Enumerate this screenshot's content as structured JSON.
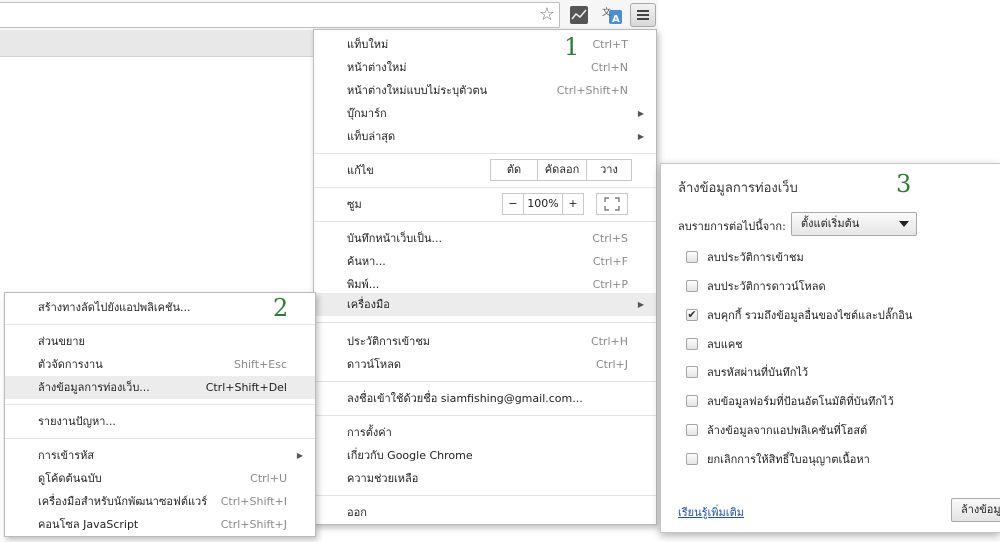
{
  "annotations": {
    "n1": "1",
    "n2": "2",
    "n3": "3"
  },
  "main_menu": {
    "new_tab": {
      "label": "แท็บใหม่",
      "shortcut": "Ctrl+T"
    },
    "new_window": {
      "label": "หน้าต่างใหม่",
      "shortcut": "Ctrl+N"
    },
    "new_incognito": {
      "label": "หน้าต่างใหม่แบบไม่ระบุตัวตน",
      "shortcut": "Ctrl+Shift+N"
    },
    "bookmarks": {
      "label": "บุ๊กมาร์ก"
    },
    "recent_tabs": {
      "label": "แท็บล่าสุด"
    },
    "edit": {
      "label": "แก้ไข",
      "cut": "ตัด",
      "copy": "คัดลอก",
      "paste": "วาง"
    },
    "zoom": {
      "label": "ซูม",
      "minus": "−",
      "value": "100%",
      "plus": "+"
    },
    "save_page": {
      "label": "บันทึกหน้าเว็บเป็น...",
      "shortcut": "Ctrl+S"
    },
    "find": {
      "label": "ค้นหา...",
      "shortcut": "Ctrl+F"
    },
    "print": {
      "label": "พิมพ์...",
      "shortcut": "Ctrl+P"
    },
    "tools": {
      "label": "เครื่องมือ"
    },
    "history": {
      "label": "ประวัติการเข้าชม",
      "shortcut": "Ctrl+H"
    },
    "downloads": {
      "label": "ดาวน์โหลด",
      "shortcut": "Ctrl+J"
    },
    "signed_in": {
      "label": "ลงชื่อเข้าใช้ด้วยชื่อ siamfishing@gmail.com..."
    },
    "settings": {
      "label": "การตั้งค่า"
    },
    "about": {
      "label": "เกี่ยวกับ Google Chrome"
    },
    "help": {
      "label": "ความช่วยเหลือ"
    },
    "exit": {
      "label": "ออก"
    }
  },
  "tools_menu": {
    "create_shortcut": {
      "label": "สร้างทางลัดไปยังแอปพลิเคชัน..."
    },
    "extensions": {
      "label": "ส่วนขยาย"
    },
    "task_manager": {
      "label": "ตัวจัดการงาน",
      "shortcut": "Shift+Esc"
    },
    "clear_data": {
      "label": "ล้างข้อมูลการท่องเว็บ...",
      "shortcut": "Ctrl+Shift+Del"
    },
    "report_issue": {
      "label": "รายงานปัญหา..."
    },
    "encoding": {
      "label": "การเข้ารหัส"
    },
    "view_source": {
      "label": "ดูโค้ดต้นฉบับ",
      "shortcut": "Ctrl+U"
    },
    "dev_tools": {
      "label": "เครื่องมือสำหรับนักพัฒนาซอฟต์แวร์",
      "shortcut": "Ctrl+Shift+I"
    },
    "js_console": {
      "label": "คอนโซล JavaScript",
      "shortcut": "Ctrl+Shift+J"
    }
  },
  "clear_dialog": {
    "title": "ล้างข้อมูลการท่องเว็บ",
    "range_label": "ลบรายการต่อไปนี้จาก:",
    "range_value": "ตั้งแต่เริ่มต้น",
    "options": [
      {
        "label": "ลบประวัติการเข้าชม",
        "checked": false
      },
      {
        "label": "ลบประวัติการดาวน์โหลด",
        "checked": false
      },
      {
        "label": "ลบคุกกี้ รวมถึงข้อมูลอื่นของไซต์และปลั๊กอิน",
        "checked": true
      },
      {
        "label": "ลบแคช",
        "checked": false
      },
      {
        "label": "ลบรหัสผ่านที่บันทึกไว้",
        "checked": false
      },
      {
        "label": "ลบข้อมูลฟอร์มที่ป้อนอัตโนมัติที่บันทึกไว้",
        "checked": false
      },
      {
        "label": "ล้างข้อมูลจากแอปพลิเคชันที่โฮสต์",
        "checked": false
      },
      {
        "label": "ยกเลิกการให้สิทธิ์ใบอนุญาตเนื้อหา",
        "checked": false
      }
    ],
    "check_mark": "✔",
    "learn_more": "เรียนรู้เพิ่มเติม",
    "clear_button": "ล้างข้อมูล"
  },
  "colors": {
    "accent_number": "#2e7d32",
    "link": "#1a4fb8"
  }
}
